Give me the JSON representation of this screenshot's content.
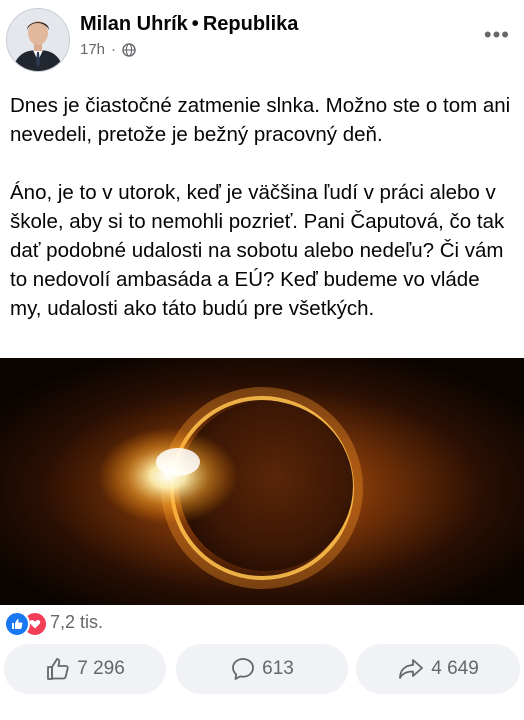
{
  "post": {
    "author_name": "Milan Uhrík",
    "separator": "•",
    "party": "Republika",
    "time": "17h",
    "meta_dot": "·",
    "privacy_icon": "globe-icon",
    "text": "Dnes je čiastočné zatmenie slnka. Možno ste o tom ani nevedeli, pretože je bežný pracovný deň.\n\nÁno, je to v utorok, keď je väčšina ľudí v práci alebo v škole, aby si to nemohli pozrieť. Pani Čaputová, čo tak dať podobné udalosti na sobotu alebo nedeľu? Či vám to nedovolí ambasáda a EÚ? Keď budeme vo vláde my, udalosti ako táto budú pre všetkých."
  },
  "reactions": {
    "count": "7,2 tis.",
    "icons": [
      "like-icon",
      "love-icon"
    ]
  },
  "actions": {
    "like_count": "7 296",
    "comment_count": "613",
    "share_count": "4 649"
  },
  "colors": {
    "like_blue": "#1877f2",
    "love_red": "#f33e58",
    "secondary_text": "#65676b",
    "button_bg": "#f0f2f5"
  }
}
